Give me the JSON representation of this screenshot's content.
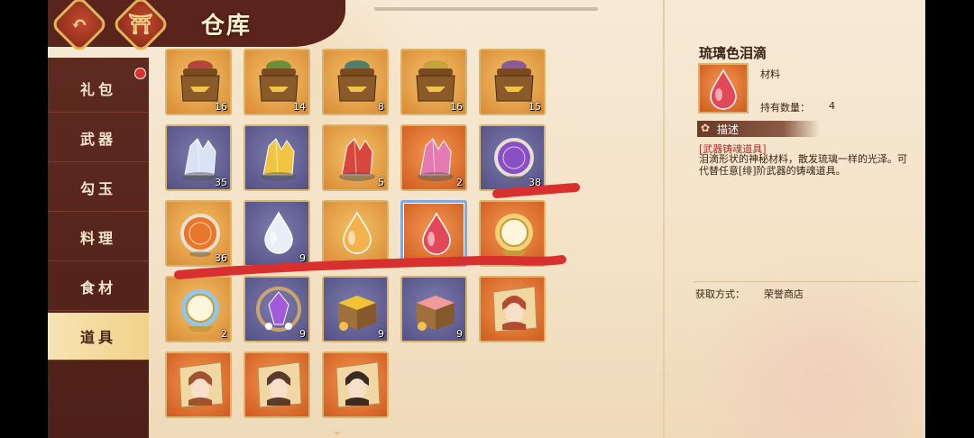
{
  "header": {
    "title": "仓库"
  },
  "sidebar": {
    "items": [
      {
        "label": "礼包"
      },
      {
        "label": "武器"
      },
      {
        "label": "勾玉"
      },
      {
        "label": "料理"
      },
      {
        "label": "食材"
      },
      {
        "label": "道具",
        "active": true
      }
    ]
  },
  "inventory": {
    "items": [
      {
        "kind": "bag",
        "icon": "lucky-bag-icon",
        "count": "16",
        "bg": "gold",
        "color": "#b5453a"
      },
      {
        "kind": "bag",
        "icon": "lucky-bag-icon",
        "count": "14",
        "bg": "gold",
        "color": "#6a8f3a"
      },
      {
        "kind": "bag",
        "icon": "lucky-bag-icon",
        "count": "8",
        "bg": "gold",
        "color": "#4f7f6a"
      },
      {
        "kind": "bag",
        "icon": "lucky-bag-icon",
        "count": "16",
        "bg": "gold",
        "color": "#c6a23a"
      },
      {
        "kind": "bag",
        "icon": "lucky-bag-icon",
        "count": "15",
        "bg": "gold",
        "color": "#8a5a9a"
      },
      {
        "kind": "crystal",
        "icon": "white-crystal-icon",
        "count": "35",
        "bg": "purple",
        "color": "#d9e2f4"
      },
      {
        "kind": "crystal",
        "icon": "gold-crystal-icon",
        "count": "",
        "bg": "purple",
        "color": "#f1c443"
      },
      {
        "kind": "crystal",
        "icon": "red-crystal-icon",
        "count": "5",
        "bg": "gold",
        "color": "#d8463c"
      },
      {
        "kind": "crystal",
        "icon": "rainbow-crystal-icon",
        "count": "2",
        "bg": "orange",
        "color": "#e57ab0"
      },
      {
        "kind": "orb",
        "icon": "purple-seal-orb-icon",
        "count": "38",
        "bg": "purple",
        "color": "#8a4fc2"
      },
      {
        "kind": "orb",
        "icon": "orange-seal-orb-icon",
        "count": "36",
        "bg": "gold",
        "color": "#e8762b"
      },
      {
        "kind": "drop",
        "icon": "white-drop-icon",
        "count": "9",
        "bg": "purple",
        "color": "#e6eef7"
      },
      {
        "kind": "drop",
        "icon": "amber-drop-icon",
        "count": "",
        "bg": "gold",
        "color": "#f3b34a"
      },
      {
        "kind": "drop",
        "icon": "red-drop-icon",
        "count": "",
        "bg": "orange",
        "color": "#e2485a",
        "selected": true
      },
      {
        "kind": "mirror",
        "icon": "gold-mirror-icon",
        "count": "",
        "bg": "orange",
        "color": "#f3d27a"
      },
      {
        "kind": "mirror",
        "icon": "blue-mirror-icon",
        "count": "2",
        "bg": "gold",
        "color": "#8fc7f0"
      },
      {
        "kind": "gem",
        "icon": "purple-gem-icon",
        "count": "9",
        "bg": "purple",
        "color": "#a35ad8"
      },
      {
        "kind": "box",
        "icon": "yellow-powder-box-icon",
        "count": "9",
        "bg": "purple",
        "color": "#f0c433"
      },
      {
        "kind": "box",
        "icon": "pink-powder-box-icon",
        "count": "9",
        "bg": "purple",
        "color": "#f29a9a"
      },
      {
        "kind": "portrait",
        "icon": "character-portrait-icon",
        "count": "",
        "bg": "orange",
        "color": "#b44a2f"
      },
      {
        "kind": "portrait",
        "icon": "character-portrait-icon",
        "count": "",
        "bg": "orange",
        "color": "#a0522d"
      },
      {
        "kind": "portrait",
        "icon": "character-portrait-icon",
        "count": "",
        "bg": "orange",
        "color": "#5a3a2a"
      },
      {
        "kind": "portrait",
        "icon": "character-portrait-icon",
        "count": "",
        "bg": "orange",
        "color": "#3b2a22"
      }
    ]
  },
  "detail": {
    "name": "琉璃色泪滴",
    "type": "材料",
    "hold_label": "持有数量：",
    "hold_value": "4",
    "desc_heading": "描述",
    "desc_tag": "[武器铸魂道具]",
    "desc_text": "泪滴形状的神秘材料，散发琉璃一样的光泽。可代替任意[绯]阶武器的铸魂道具。",
    "acquire_label": "获取方式：",
    "acquire_value": "荣誉商店"
  }
}
